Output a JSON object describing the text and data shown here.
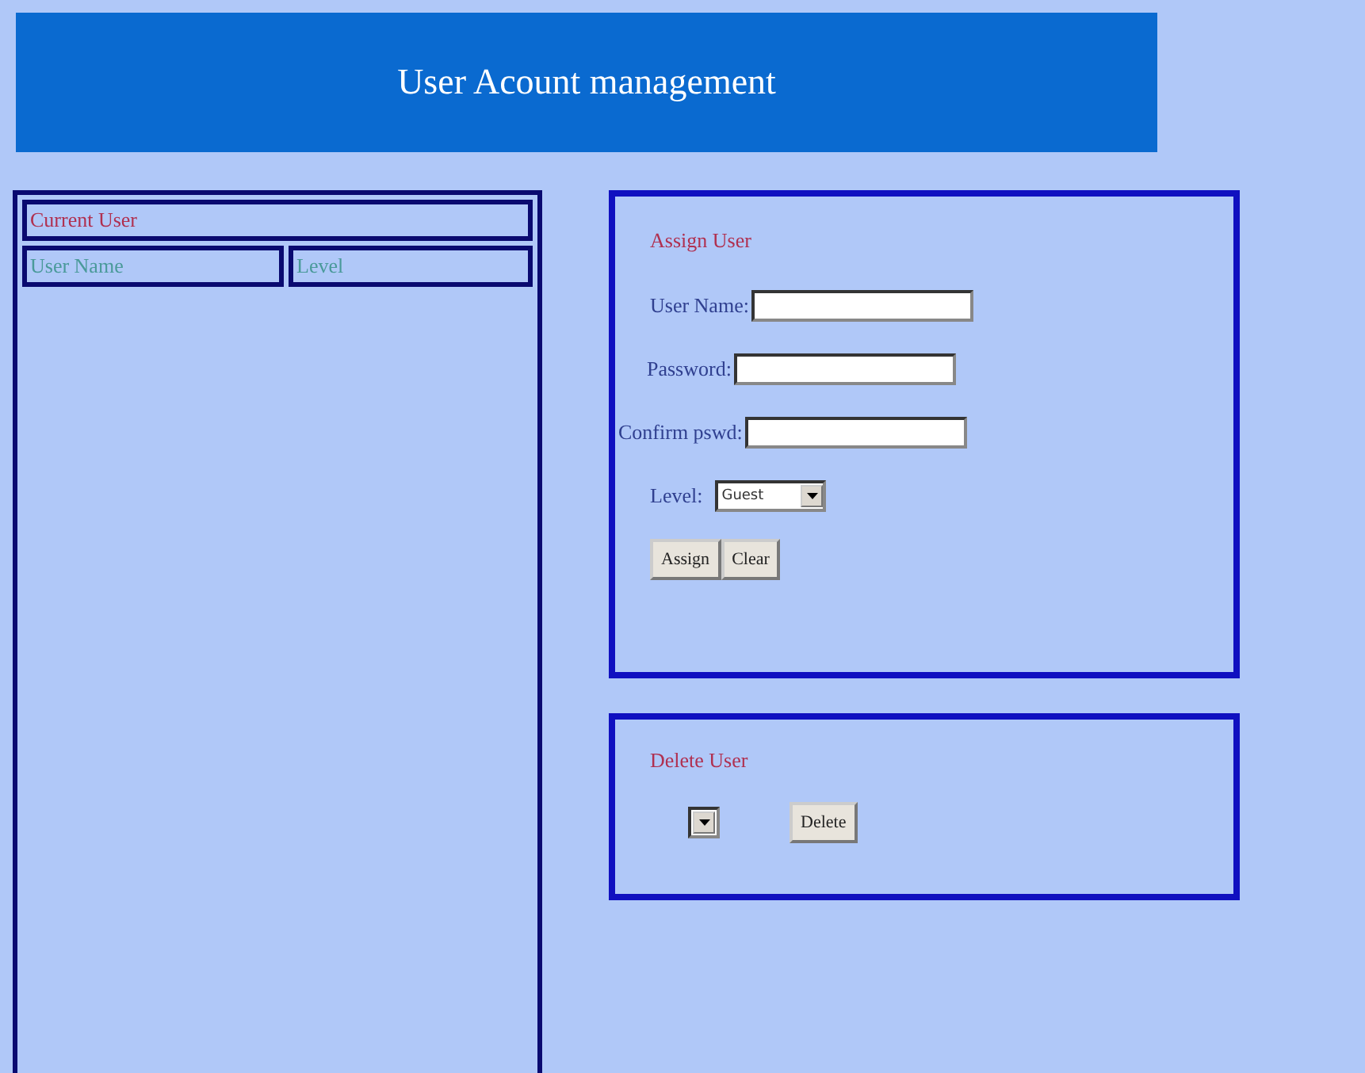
{
  "header": {
    "title": "User Acount management"
  },
  "current_users": {
    "title": "Current User",
    "columns": [
      "User Name",
      "Level"
    ]
  },
  "assign_user": {
    "title": "Assign User",
    "fields": [
      {
        "label": "User Name:"
      },
      {
        "label": "Password:"
      },
      {
        "label": "Confirm pswd:"
      }
    ],
    "level": {
      "label": "Level:",
      "value": "Guest"
    },
    "buttons": [
      "Assign",
      "Clear"
    ]
  },
  "delete_user": {
    "title": "Delete User",
    "button": "Delete"
  }
}
